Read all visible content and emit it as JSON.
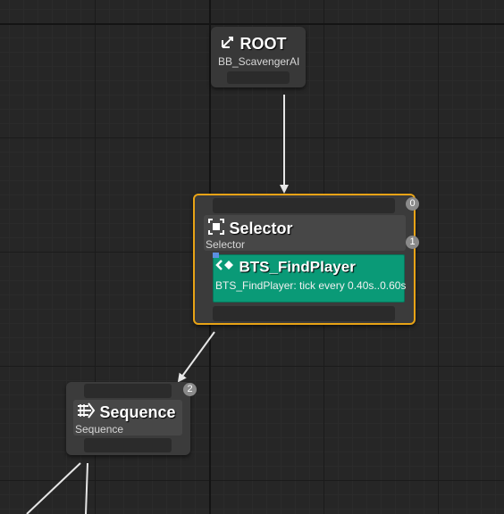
{
  "root_node": {
    "title": "ROOT",
    "subtitle": "BB_ScavengerAI"
  },
  "selector_node": {
    "title": "Selector",
    "subtitle": "Selector",
    "badge_top": "0",
    "badge_side": "1",
    "service": {
      "title": "BTS_FindPlayer",
      "description": "BTS_FindPlayer: tick every 0.40s..0.60s"
    }
  },
  "sequence_node": {
    "title": "Sequence",
    "subtitle": "Sequence",
    "badge": "2"
  },
  "colors": {
    "graph_bg": "#262626",
    "node_body": "#3d3d3d",
    "selected_outline": "#e8a316",
    "service_green": "#0a9a77",
    "wire": "#e6e6e6",
    "badge": "#8a8a8a"
  }
}
